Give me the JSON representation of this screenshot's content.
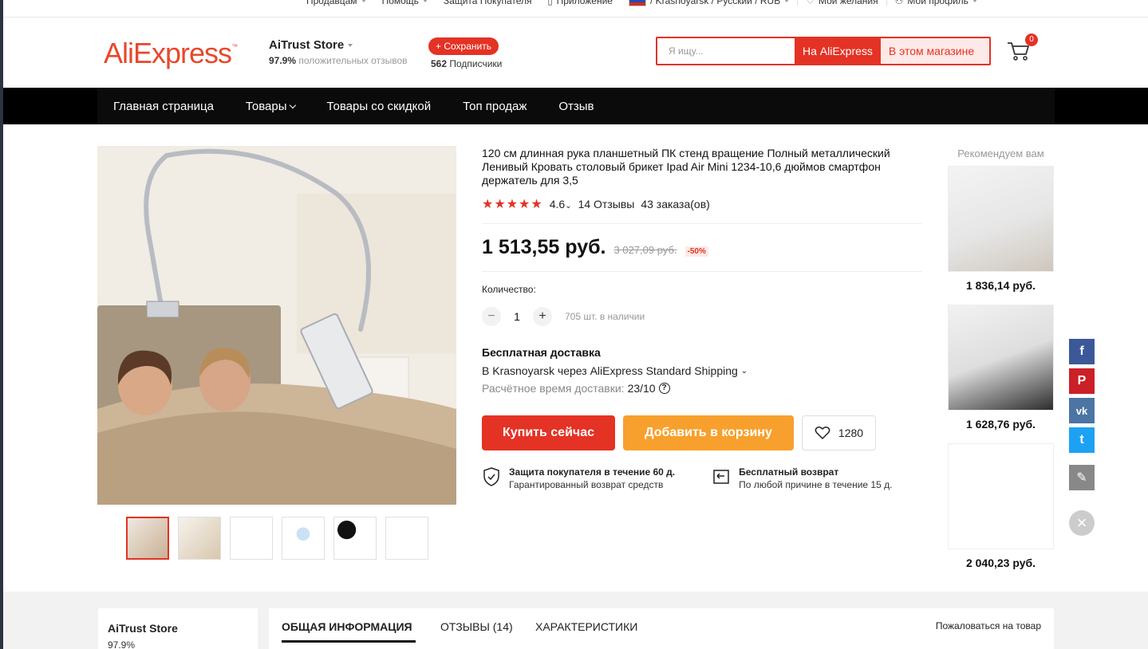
{
  "topbar": {
    "sellers": "Продавцам",
    "help": "Помощь",
    "protection": "Защита Покупателя",
    "app": "Приложение",
    "region": "/ Krasnoyarsk / Русский / RUB",
    "wishlist": "Мои желания",
    "profile": "Мой профиль"
  },
  "header": {
    "logo": "AliExpress",
    "store_name": "AiTrust Store",
    "positive_pct": "97.9%",
    "positive_label": "положительных отзывов",
    "follow_label": "+ Сохранить",
    "subscribers_count": "562",
    "subscribers_label": "Подписчики",
    "search_placeholder": "Я ищу...",
    "search_ali": "На AliExpress",
    "search_store": "В этом магазине",
    "cart_count": "0"
  },
  "nav": {
    "items": [
      "Главная страница",
      "Товары",
      "Товары со скидкой",
      "Топ продаж",
      "Отзыв"
    ]
  },
  "product": {
    "title": "120 см длинная рука планшетный ПК стенд вращение Полный металлический Ленивый Кровать столовый брикет Ipad Air Mini 1234-10,6 дюймов смартфон держатель для 3,5",
    "stars": "★★★★★",
    "rating": "4.6",
    "reviews": "14 Отзывы",
    "orders": "43 заказа(ов)",
    "price": "1 513,55 руб.",
    "old_price": "3 027,09 руб.",
    "discount": "-50%",
    "qty_label": "Количество:",
    "qty_minus": "−",
    "qty_value": "1",
    "qty_plus": "+",
    "stock": "705 шт. в наличии",
    "shipping_title": "Бесплатная доставка",
    "shipping_detail": "В Krasnoyarsk через AliExpress Standard Shipping",
    "delivery_label": "Расчётное время доставки:",
    "delivery_date": "23/10",
    "buy_now": "Купить сейчас",
    "add_to_cart": "Добавить в корзину",
    "wish_count": "1280",
    "guarantee1_title": "Защита покупателя в течение 60 д.",
    "guarantee1_sub": "Гарантированный возврат средств",
    "guarantee2_title": "Бесплатный возврат",
    "guarantee2_sub": "По любой причине в течение 15 д."
  },
  "recommend": {
    "title": "Рекомендуем вам",
    "items": [
      {
        "price": "1 836,14 руб."
      },
      {
        "price": "1 628,76 руб."
      },
      {
        "price": "2 040,23 руб."
      }
    ]
  },
  "social": {
    "facebook": "f",
    "pinterest": "P",
    "vk": "vk",
    "twitter": "t",
    "edit": "✎",
    "close": "×"
  },
  "bottom": {
    "store_name": "AiTrust Store",
    "store_pct": "97.9%",
    "tabs": [
      "ОБЩАЯ ИНФОРМАЦИЯ",
      "ОТЗЫВЫ (14)",
      "ХАРАКТЕРИСТИКИ"
    ],
    "report": "Пожаловаться на товар"
  },
  "colors": {
    "accent": "#e43225",
    "cart_orange": "#f7a02d",
    "facebook": "#3b5998",
    "pinterest": "#cb2027",
    "vk": "#4c75a3",
    "twitter": "#1da1f2",
    "edit": "#888888"
  }
}
